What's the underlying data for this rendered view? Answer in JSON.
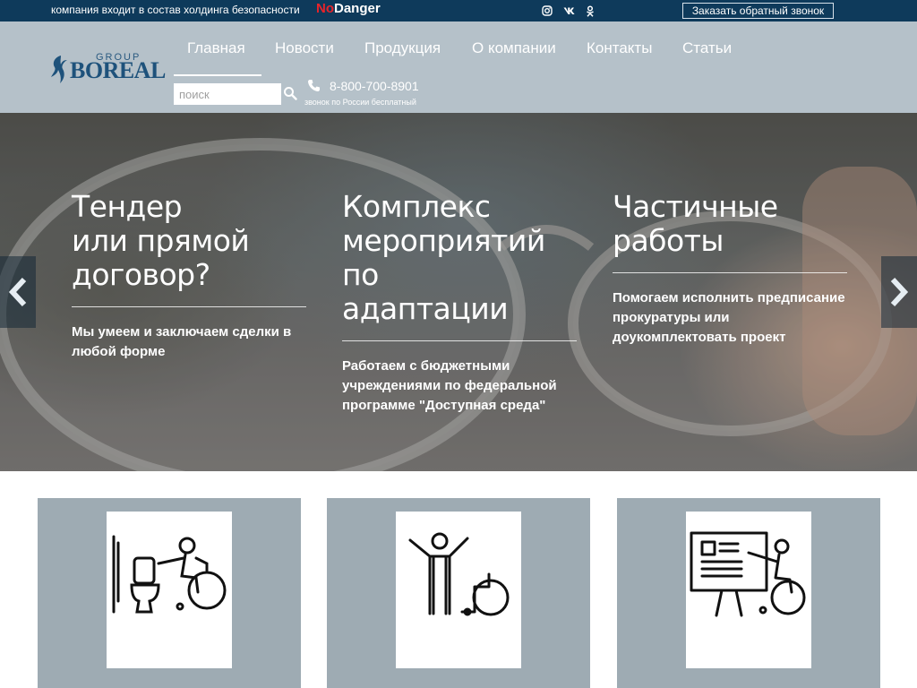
{
  "topbar": {
    "holding_text": "компания входит в состав холдинга безопасности",
    "brand_no": "No",
    "brand_danger": "Danger",
    "social": [
      "instagram-icon",
      "vk-icon",
      "odnoklassniki-icon"
    ],
    "callback_label": "Заказать обратный звонок"
  },
  "logo": {
    "group": "GROUP",
    "name": "BOREAL"
  },
  "nav": {
    "items": [
      {
        "label": "Главная",
        "active": true
      },
      {
        "label": "Новости"
      },
      {
        "label": "Продукция"
      },
      {
        "label": "О компании"
      },
      {
        "label": "Контакты"
      },
      {
        "label": "Статьи"
      }
    ]
  },
  "search": {
    "placeholder": "поиск"
  },
  "contact": {
    "phone": "8-800-700-8901",
    "note": "звонок по России бесплатный"
  },
  "hero": {
    "columns": [
      {
        "title": "Тендер\nили прямой\nдоговор?",
        "text": "Мы умеем и заключаем сделки в любой форме"
      },
      {
        "title": "Комплекс\nмероприятий по\nадаптации",
        "text": "Работаем с бюджетными учреждениями по федеральной программе \"Доступная среда\""
      },
      {
        "title": "Частичные\nработы",
        "text": "Помогаем исполнить предписание прокуратуры или доукомплектовать проект"
      }
    ]
  },
  "cards": [
    {
      "icon": "accessible-toilet-icon"
    },
    {
      "icon": "person-and-wheelchair-icon"
    },
    {
      "icon": "presentation-wheelchair-icon"
    }
  ],
  "colors": {
    "topbar": "#0e3a5b",
    "header": "#b5c1c9",
    "card": "#9eabb3",
    "brand_red": "#e8232a"
  }
}
